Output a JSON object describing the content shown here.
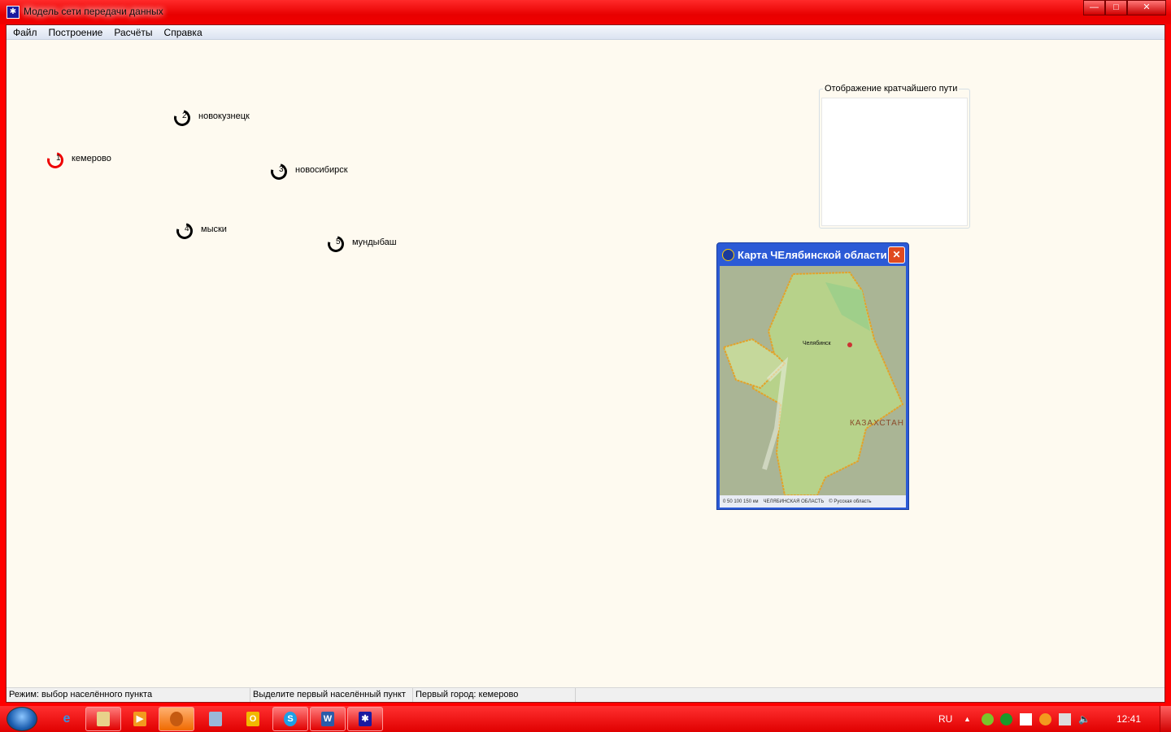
{
  "window": {
    "title": "Модель сети передачи данных",
    "min": "—",
    "max": "□",
    "close": "✕"
  },
  "menu": [
    "Файл",
    "Построение",
    "Расчёты",
    "Справка"
  ],
  "nodes": [
    {
      "num": "1",
      "label": "кемерово",
      "selected": true
    },
    {
      "num": "2",
      "label": "новокузнецк",
      "selected": false
    },
    {
      "num": "3",
      "label": "новосибирск",
      "selected": false
    },
    {
      "num": "4",
      "label": "мыски",
      "selected": false
    },
    {
      "num": "5",
      "label": "мундыбаш",
      "selected": false
    }
  ],
  "path_group": {
    "title": "Отображение кратчайшего пути"
  },
  "map_window": {
    "title": "Карта ЧЕлябинской области",
    "close": "✕",
    "region_label": "КАЗАХСТАН",
    "city": "Челябинск",
    "footer_scale": "0   50   100   150 км",
    "footer_name": "ЧЕЛЯБИНСКАЯ ОБЛАСТЬ",
    "footer_right": "© Русская область"
  },
  "status": {
    "mode": "Режим: выбор населённого пункта",
    "hint": "Выделите первый населённый пункт",
    "first_city": "Первый город: кемерово"
  },
  "taskbar": {
    "lang": "RU",
    "time": "12:41"
  },
  "colors": {
    "selected_node": "#ee0000",
    "canvas_bg": "#fefaf0",
    "frame": "#ff0000"
  }
}
